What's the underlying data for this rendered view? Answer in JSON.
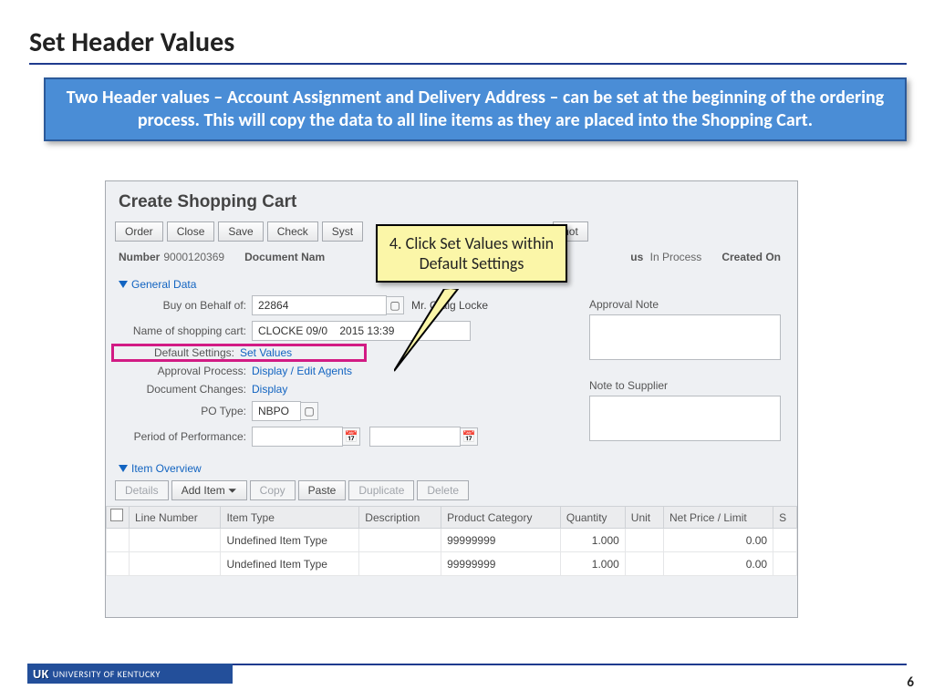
{
  "slide": {
    "title": "Set Header Values",
    "description": "Two Header values – Account Assignment and Delivery Address – can be set at the beginning of the ordering process. This will copy the data to all line items as they are placed into the Shopping Cart.",
    "page_number": "6",
    "footer_logo": "UNIVERSITY OF KENTUCKY",
    "footer_logo_prefix": "UK"
  },
  "app": {
    "title": "Create Shopping Cart",
    "toolbar": {
      "order": "Order",
      "close": "Close",
      "save": "Save",
      "check": "Check",
      "syst": "Syst",
      "hot": "hot"
    },
    "meta": {
      "number_label": "Number",
      "number_value": "9000120369",
      "docname_label": "Document Nam",
      "status_label": "us",
      "status_value": "In Process",
      "created_label": "Created On"
    },
    "general": {
      "header": "General Data",
      "buy_label": "Buy on Behalf of:",
      "buy_value": "22864",
      "buy_name": "Mr. Craig Locke",
      "cart_label": "Name of shopping cart:",
      "cart_value": "CLOCKE 09/0    2015 13:39",
      "defset_label": "Default Settings:",
      "defset_link": "Set Values",
      "appr_label": "Approval Process:",
      "appr_link": "Display / Edit Agents",
      "docchg_label": "Document Changes:",
      "docchg_link": "Display",
      "po_label": "PO Type:",
      "po_value": "NBPO",
      "pop_label": "Period of Performance:"
    },
    "right": {
      "approval_note": "Approval Note",
      "note_supplier": "Note to Supplier"
    },
    "items": {
      "header": "Item Overview",
      "toolbar": {
        "details": "Details",
        "add": "Add Item",
        "copy": "Copy",
        "paste": "Paste",
        "duplicate": "Duplicate",
        "delete": "Delete"
      },
      "cols": {
        "line": "Line Number",
        "itype": "Item Type",
        "desc": "Description",
        "pcat": "Product Category",
        "qty": "Quantity",
        "unit": "Unit",
        "price": "Net Price / Limit",
        "s": "S"
      },
      "rows": [
        {
          "type": "Undefined Item Type",
          "pcat": "99999999",
          "qty": "1.000",
          "price": "0.00"
        },
        {
          "type": "Undefined Item Type",
          "pcat": "99999999",
          "qty": "1.000",
          "price": "0.00"
        }
      ]
    }
  },
  "step_callout": "4. Click Set Values within Default Settings"
}
